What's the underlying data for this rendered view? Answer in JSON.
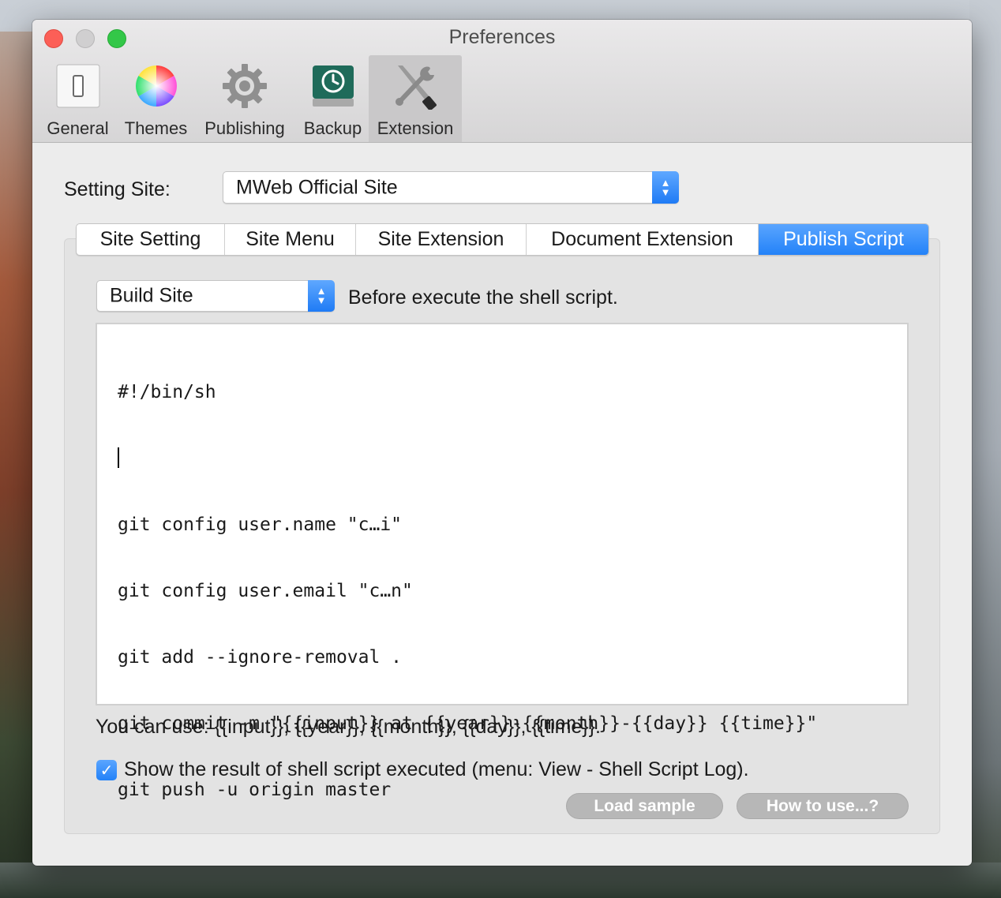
{
  "window": {
    "title": "Preferences"
  },
  "toolbar": {
    "items": [
      {
        "label": "General",
        "icon": "switch-icon"
      },
      {
        "label": "Themes",
        "icon": "color-wheel-icon"
      },
      {
        "label": "Publishing",
        "icon": "gear-icon"
      },
      {
        "label": "Backup",
        "icon": "time-machine-icon"
      },
      {
        "label": "Extension",
        "icon": "tools-icon",
        "selected": true
      }
    ]
  },
  "setting_site": {
    "label": "Setting Site:",
    "value": "MWeb Official Site"
  },
  "tabs": [
    {
      "label": "Site Setting"
    },
    {
      "label": "Site Menu"
    },
    {
      "label": "Site Extension"
    },
    {
      "label": "Document Extension"
    },
    {
      "label": "Publish Script",
      "active": true
    }
  ],
  "script_stage": {
    "value": "Build Site",
    "description": "Before execute the shell script."
  },
  "editor": {
    "lines": [
      "#!/bin/sh",
      "",
      "git config user.name \"c…i\"",
      "git config user.email \"c…n\"",
      "git add --ignore-removal .",
      "git commit -m \"{{input}} at {{year}}-{{month}}-{{day}} {{time}}\"",
      "git push -u origin master"
    ]
  },
  "variables_hint": "You can use: {{input}}, {{year}}, {{month}}, {{day}}, {{time}}.",
  "show_result": {
    "checked": true,
    "label": "Show  the result of shell script executed (menu: View - Shell Script Log)."
  },
  "buttons": {
    "load_sample": "Load sample",
    "how_to_use": "How to use...?"
  },
  "colors": {
    "accent": "#2382f8",
    "close": "#fc5f57",
    "zoom": "#33c748",
    "button_gray": "#b7b7b7"
  }
}
